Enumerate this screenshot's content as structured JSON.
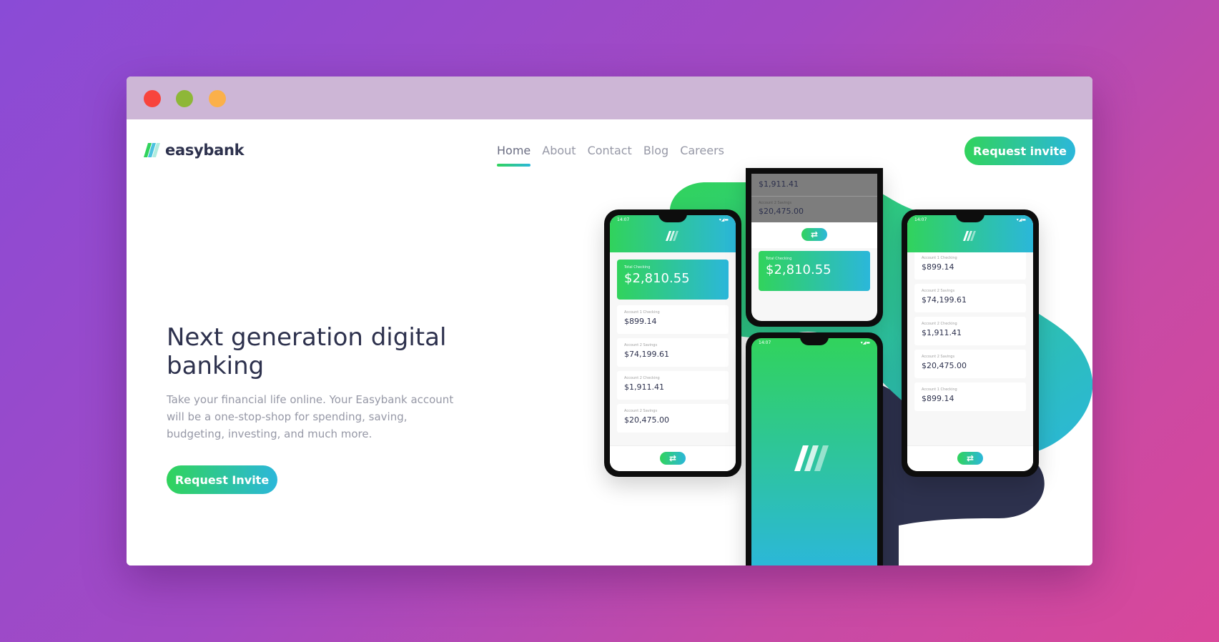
{
  "brand": {
    "name": "easybank"
  },
  "nav": {
    "items": [
      "Home",
      "About",
      "Contact",
      "Blog",
      "Careers"
    ],
    "active": "Home"
  },
  "header": {
    "cta_label": "Request invite"
  },
  "hero": {
    "title": "Next generation digital banking",
    "text": "Take your financial life online. Your Easybank account will be a one-stop-shop for spending, saving, budgeting, investing, and much more.",
    "cta_label": "Request Invite"
  },
  "colors": {
    "dark_blue": "#2d314d",
    "lime_green": "#31d35c",
    "bright_cyan": "#2bb7da",
    "grayish_blue": "#9698a6"
  },
  "phones": {
    "status_time": "14:07",
    "left": {
      "total_label": "Total Checking",
      "total_amount": "$2,810.55",
      "accounts": [
        {
          "label": "Account 1 Checking",
          "amount": "$899.14"
        },
        {
          "label": "Account 2 Savings",
          "amount": "$74,199.61"
        },
        {
          "label": "Account 2 Checking",
          "amount": "$1,911.41"
        },
        {
          "label": "Account 2 Savings",
          "amount": "$20,475.00"
        }
      ]
    },
    "top_center": {
      "accounts": [
        {
          "label": "",
          "amount": "$1,911.41"
        },
        {
          "label": "Account 2 Savings",
          "amount": "$20,475.00"
        }
      ],
      "total_label": "Total Checking",
      "total_amount": "$2,810.55"
    },
    "right": {
      "accounts": [
        {
          "label": "Account 1 Checking",
          "amount": "$899.14"
        },
        {
          "label": "Account 2 Savings",
          "amount": "$74,199.61"
        },
        {
          "label": "Account 2 Checking",
          "amount": "$1,911.41"
        },
        {
          "label": "Account 2 Savings",
          "amount": "$20,475.00"
        },
        {
          "label": "Account 1 Checking",
          "amount": "$899.14"
        }
      ]
    }
  }
}
